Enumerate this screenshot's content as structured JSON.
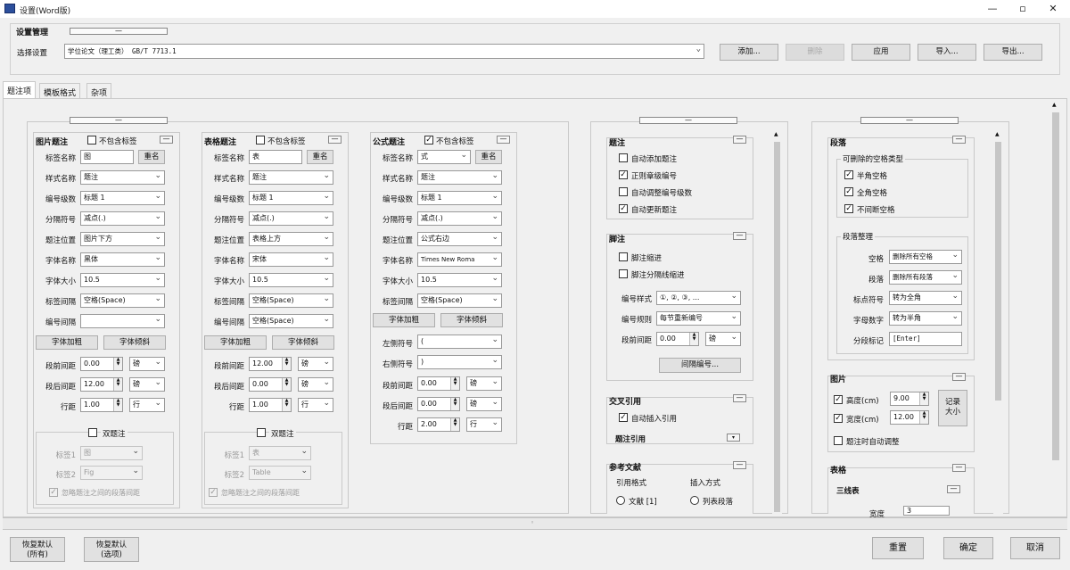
{
  "window": {
    "title": "设置(Word版)",
    "minimize": "—",
    "restore": "▫",
    "close": "✕"
  },
  "settings_mgmt": {
    "title": "设置管理",
    "label": "选择设置",
    "selected": "学位论文（理工类） GB/T 7713.1",
    "buttons": {
      "add": "添加...",
      "delete": "删除",
      "apply": "应用",
      "import": "导入...",
      "export": "导出..."
    }
  },
  "tabs": [
    "题注项",
    "模板格式",
    "杂项"
  ],
  "figure": {
    "title": "图片题注",
    "no_label": "不包含标签",
    "label_name": "标签名称",
    "label_value": "图",
    "rename": "重名",
    "style_name": "样式名称",
    "style_value": "题注",
    "level": "编号级数",
    "level_value": "标题 1",
    "separator": "分隔符号",
    "separator_value": "减点(.)",
    "position": "题注位置",
    "position_value": "图片下方",
    "font_name": "字体名称",
    "font_value": "黑体",
    "font_size": "字体大小",
    "font_size_value": "10.5",
    "label_gap": "标签间隔",
    "label_gap_value": "空格(Space)",
    "num_gap": "编号间隔",
    "num_gap_value": "",
    "bold": "字体加粗",
    "italic": "字体倾斜",
    "before": "段前间距",
    "before_value": "0.00",
    "before_unit": "磅",
    "after": "段后间距",
    "after_value": "12.00",
    "after_unit": "磅",
    "line": "行距",
    "line_value": "1.00",
    "line_unit": "行",
    "dual": "双题注",
    "tag1": "标签1",
    "tag1_value": "图",
    "tag2": "标签2",
    "tag2_value": "Fig",
    "ignore": "忽略题注之间的段落间距"
  },
  "table": {
    "title": "表格题注",
    "no_label": "不包含标签",
    "label_name": "标签名称",
    "label_value": "表",
    "rename": "重名",
    "style_name": "样式名称",
    "style_value": "题注",
    "level": "编号级数",
    "level_value": "标题 1",
    "separator": "分隔符号",
    "separator_value": "减点(.)",
    "position": "题注位置",
    "position_value": "表格上方",
    "font_name": "字体名称",
    "font_value": "宋体",
    "font_size": "字体大小",
    "font_size_value": "10.5",
    "label_gap": "标签间隔",
    "label_gap_value": "空格(Space)",
    "num_gap": "编号间隔",
    "num_gap_value": "空格(Space)",
    "bold": "字体加粗",
    "italic": "字体倾斜",
    "before": "段前间距",
    "before_value": "12.00",
    "before_unit": "磅",
    "after": "段后间距",
    "after_value": "0.00",
    "after_unit": "磅",
    "line": "行距",
    "line_value": "1.00",
    "line_unit": "行",
    "dual": "双题注",
    "tag1": "标签1",
    "tag1_value": "表",
    "tag2": "标签2",
    "tag2_value": "Table",
    "ignore": "忽略题注之间的段落间距"
  },
  "equation": {
    "title": "公式题注",
    "no_label": "不包含标签",
    "label_name": "标签名称",
    "label_value": "式",
    "rename": "重名",
    "style_name": "样式名称",
    "style_value": "题注",
    "level": "编号级数",
    "level_value": "标题 1",
    "separator": "分隔符号",
    "separator_value": "减点(.)",
    "position": "题注位置",
    "position_value": "公式右边",
    "font_name": "字体名称",
    "font_value": "Times New Roma",
    "font_size": "字体大小",
    "font_size_value": "10.5",
    "label_gap": "标签间隔",
    "label_gap_value": "空格(Space)",
    "bold": "字体加粗",
    "italic": "字体倾斜",
    "left_wrap": "左侧符号",
    "left_wrap_value": "(",
    "right_wrap": "右侧符号",
    "right_wrap_value": ")",
    "before": "段前间距",
    "before_value": "0.00",
    "before_unit": "磅",
    "after": "段后间距",
    "after_value": "0.00",
    "after_unit": "磅",
    "line": "行距",
    "line_value": "2.00",
    "line_unit": "行"
  },
  "caption": {
    "title": "题注",
    "auto_add": "自动添加题注",
    "chapter_num": "正则章级编号",
    "auto_adjust": "自动调整编号级数",
    "auto_update": "自动更新题注"
  },
  "footnote": {
    "title": "脚注",
    "fn_indent": "脚注缩进",
    "fn_hanging": "脚注分隔线缩进",
    "num_style": "编号样式",
    "num_style_value": "①, ②, ③, ...",
    "num_rule": "编号规则",
    "num_rule_value": "每节重新编号",
    "spacing": "段前间距",
    "spacing_value": "0.00",
    "spacing_unit": "磅",
    "reset": "间隔编号..."
  },
  "crossref": {
    "title": "交叉引用",
    "auto_insert": "自动插入引用",
    "caption_ref": "题注引用"
  },
  "biblio": {
    "title": "参考文献",
    "cite_style": "引用格式",
    "insert_mode": "插入方式",
    "opt1": "文献 [1]",
    "opt2": "列表段落"
  },
  "paragraph": {
    "title": "段落",
    "space_types": "可删除的空格类型",
    "half": "半角空格",
    "full": "全角空格",
    "nonbreak": "不间断空格",
    "para_org": "段落整理",
    "space": "空格",
    "space_value": "删除所有空格",
    "para": "段落",
    "para_value": "删除所有段落",
    "punct": "标点符号",
    "punct_value": "转为全角",
    "alnum": "字母数字",
    "alnum_value": "转为半角",
    "split": "分段标记",
    "split_value": "[Enter]"
  },
  "picture": {
    "title": "图片",
    "height": "高度(cm)",
    "height_value": "9.00",
    "width": "宽度(cm)",
    "width_value": "12.00",
    "record": "记录\n大小",
    "auto_adjust": "题注时自动调整"
  },
  "tables": {
    "title": "表格",
    "three_line": "三线表",
    "width": "宽度",
    "width_value": "3"
  },
  "footer": {
    "restore_all": "恢复默认\n(所有)",
    "restore_cur": "恢复默认\n(选项)",
    "reset": "重置",
    "ok": "确定",
    "cancel": "取消"
  }
}
